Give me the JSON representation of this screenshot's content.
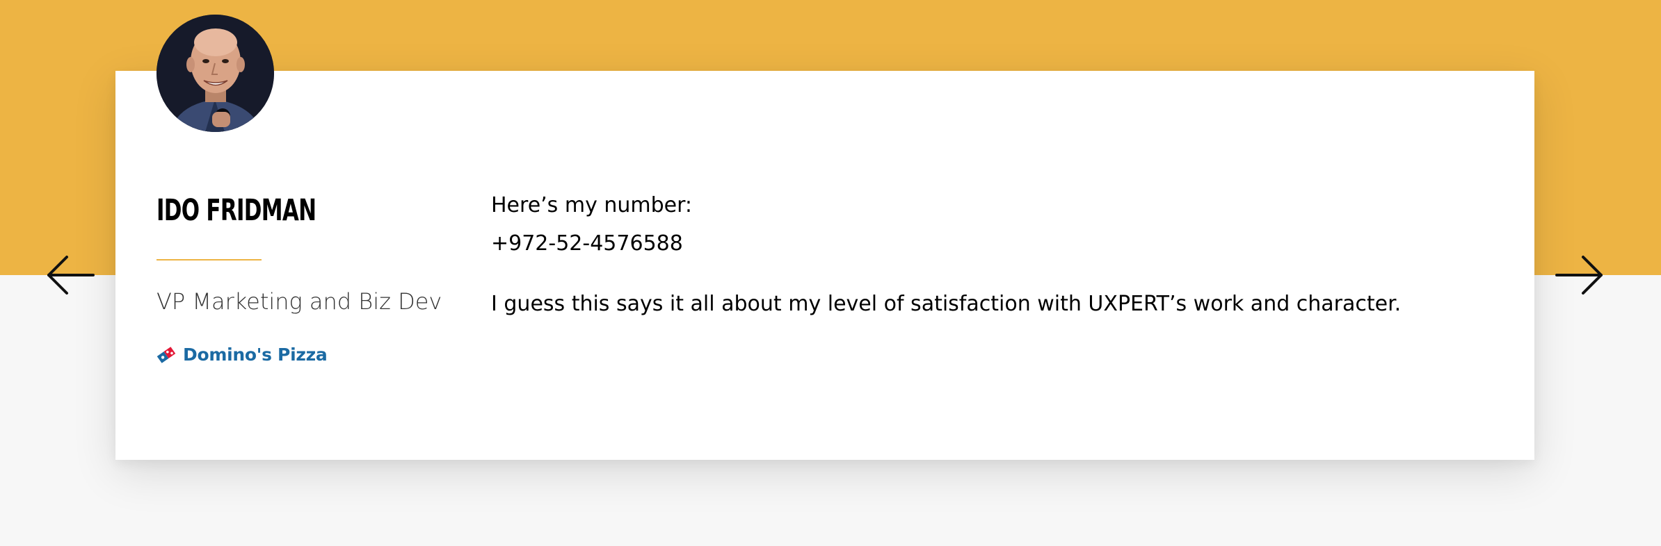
{
  "testimonial": {
    "name": "IDO FRIDMAN",
    "role": "VP Marketing and Biz Dev",
    "company": "Domino's Pizza",
    "quote_lines": [
      "Here’s my number:",
      "+972-52-4576588",
      "I guess this says it all about my level of satisfaction with UXPERT’s work and character."
    ]
  },
  "navigation": {
    "prev_icon": "arrow-left-icon",
    "next_icon": "arrow-right-icon"
  },
  "colors": {
    "accent": "#edb444",
    "page_background": "#f7f7f7",
    "card_background": "#ffffff",
    "brand_blue": "#1b6aa3",
    "brand_red": "#e31837"
  }
}
